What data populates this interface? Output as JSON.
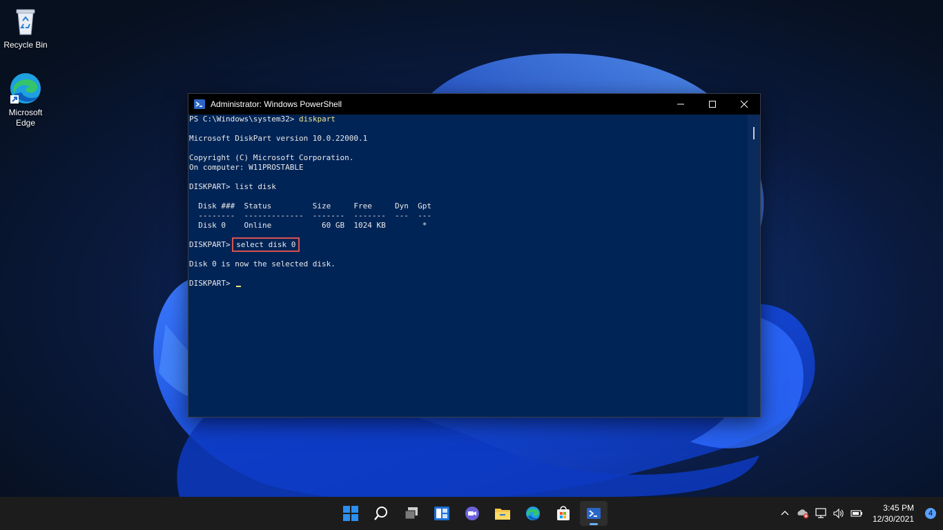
{
  "desktop": {
    "icons": [
      {
        "label": "Recycle Bin"
      },
      {
        "label_line1": "Microsoft",
        "label_line2": "Edge"
      }
    ]
  },
  "window": {
    "title": "Administrator: Windows PowerShell"
  },
  "console": {
    "lines": [
      "PS C:\\Windows\\system32> ",
      "diskpart",
      "",
      "Microsoft DiskPart version 10.0.22000.1",
      "",
      "Copyright (C) Microsoft Corporation.",
      "On computer: W11PROSTABLE",
      "",
      "DISKPART> list disk",
      "",
      "  Disk ###  Status         Size     Free     Dyn  Gpt",
      "  --------  -------------  -------  -------  ---  ---",
      "  Disk 0    Online           60 GB  1024 KB        *",
      "",
      "DISKPART> ",
      "select disk 0",
      "",
      "Disk 0 is now the selected disk.",
      "",
      "DISKPART> "
    ]
  },
  "taskbar": {
    "apps": [
      "start",
      "search",
      "task-view",
      "widgets",
      "chat",
      "file-explorer",
      "edge",
      "store",
      "powershell"
    ],
    "time": "3:45 PM",
    "date": "12/30/2021",
    "notification_count": "4"
  },
  "colors": {
    "console_bg": "#012456",
    "highlight": "#d9534f",
    "accent": "#6ab0ff"
  }
}
